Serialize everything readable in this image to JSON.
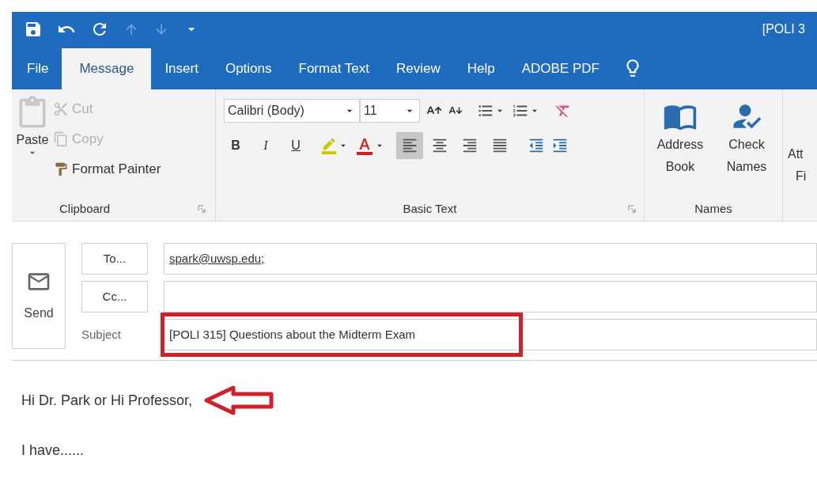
{
  "window": {
    "title": "[POLI 3"
  },
  "tabs": [
    {
      "label": "File",
      "selected": false
    },
    {
      "label": "Message",
      "selected": true
    },
    {
      "label": "Insert",
      "selected": false
    },
    {
      "label": "Options",
      "selected": false
    },
    {
      "label": "Format Text",
      "selected": false
    },
    {
      "label": "Review",
      "selected": false
    },
    {
      "label": "Help",
      "selected": false
    },
    {
      "label": "ADOBE PDF",
      "selected": false
    }
  ],
  "ribbon": {
    "clipboard": {
      "label": "Clipboard",
      "paste": "Paste",
      "items": [
        {
          "label": "Cut",
          "disabled": true
        },
        {
          "label": "Copy",
          "disabled": true
        },
        {
          "label": "Format Painter",
          "disabled": false
        }
      ]
    },
    "basic_text": {
      "label": "Basic Text",
      "font": "Calibri (Body)",
      "size": "11",
      "format_buttons": [
        "B",
        "I",
        "U"
      ],
      "alignment": [
        {
          "kind": "left",
          "selected": true
        },
        {
          "kind": "center",
          "selected": false
        },
        {
          "kind": "right",
          "selected": false
        },
        {
          "kind": "justify",
          "selected": false
        }
      ]
    },
    "names": {
      "label": "Names",
      "buttons": [
        {
          "kind": "address_book",
          "label": "Address Book"
        },
        {
          "kind": "check_names",
          "label": "Check Names"
        }
      ]
    },
    "attach": {
      "line_1": "Att",
      "line_2": "Fi"
    }
  },
  "compose": {
    "send": "Send",
    "to_button": "To...",
    "to_value": "spark@uwsp.edu;",
    "cc_button": "Cc...",
    "subject_label": "Subject",
    "subject_value": "[POLI 315] Questions about the Midterm Exam"
  },
  "body": {
    "lines": [
      "Hi Dr. Park or Hi Professor,",
      "I have......"
    ]
  }
}
